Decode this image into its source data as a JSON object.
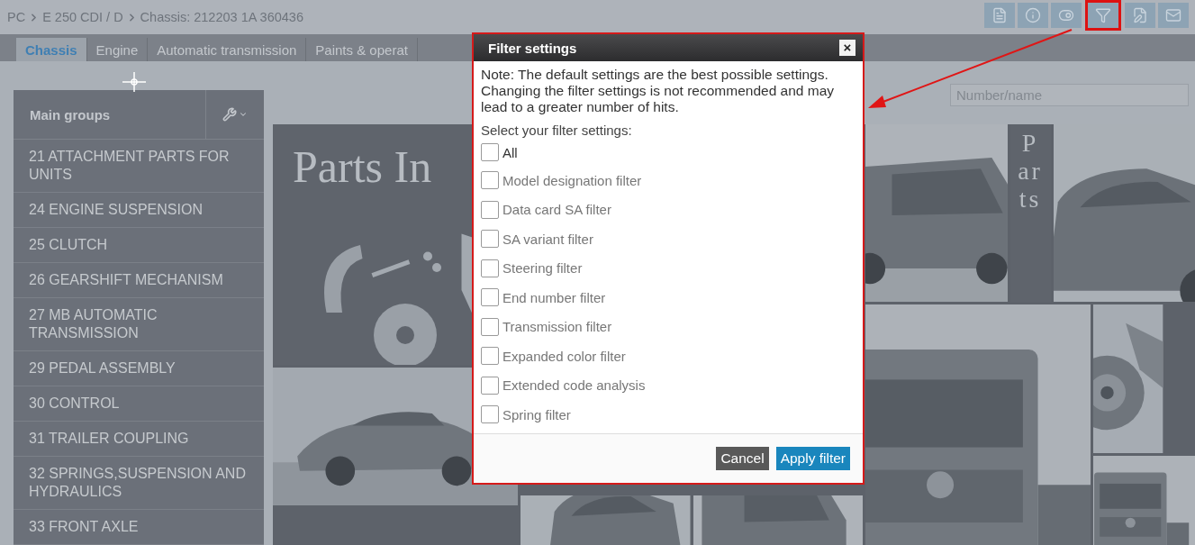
{
  "breadcrumb": [
    "PC",
    "E 250 CDI / D",
    "Chassis: 212203 1A 360436"
  ],
  "toolbar": [
    {
      "kind": "document-car",
      "highlighted": false
    },
    {
      "kind": "info",
      "highlighted": false
    },
    {
      "kind": "toggle",
      "highlighted": false
    },
    {
      "kind": "filter",
      "highlighted": true
    },
    {
      "kind": "document-edit",
      "highlighted": false
    },
    {
      "kind": "mail",
      "highlighted": false
    }
  ],
  "tabs": [
    {
      "label": "Chassis",
      "selected": true
    },
    {
      "label": "Engine",
      "selected": false
    },
    {
      "label": "Automatic transmission",
      "selected": false
    },
    {
      "label": "Paints & operat",
      "selected": false
    }
  ],
  "sidebar": {
    "header": "Main groups",
    "items": [
      "21 ATTACHMENT PARTS FOR UNITS",
      "24 ENGINE SUSPENSION",
      "25 CLUTCH",
      "26 GEARSHIFT MECHANISM",
      "27 MB AUTOMATIC TRANSMISSION",
      "29 PEDAL ASSEMBLY",
      "30 CONTROL",
      "31 TRAILER COUPLING",
      "32 SPRINGS,SUSPENSION AND HYDRAULICS",
      "33 FRONT AXLE"
    ]
  },
  "search": {
    "placeholder": "Number/name"
  },
  "banner": {
    "title": "Parts In",
    "side_word": "Parts"
  },
  "dialog": {
    "title": "Filter settings",
    "close": "×",
    "note": "Note: The default settings are the best possible settings. Changing the filter settings is not recommended and may lead to a greater number of hits.",
    "prompt": "Select your filter settings:",
    "options": [
      {
        "kind": "all",
        "label": "All",
        "checked": false
      },
      {
        "kind": "filter",
        "label": "Model designation filter",
        "checked": false
      },
      {
        "kind": "filter",
        "label": "Data card SA filter",
        "checked": false
      },
      {
        "kind": "filter",
        "label": "SA variant filter",
        "checked": false
      },
      {
        "kind": "filter",
        "label": "Steering filter",
        "checked": false
      },
      {
        "kind": "filter",
        "label": "End number filter",
        "checked": false
      },
      {
        "kind": "filter",
        "label": "Transmission filter",
        "checked": false
      },
      {
        "kind": "filter",
        "label": "Expanded color filter",
        "checked": false
      },
      {
        "kind": "filter",
        "label": "Extended code analysis",
        "checked": false
      },
      {
        "kind": "filter",
        "label": "Spring filter",
        "checked": false
      }
    ],
    "buttons": [
      {
        "kind": "secondary",
        "label": "Cancel"
      },
      {
        "kind": "primary",
        "label": "Apply filter"
      }
    ]
  }
}
